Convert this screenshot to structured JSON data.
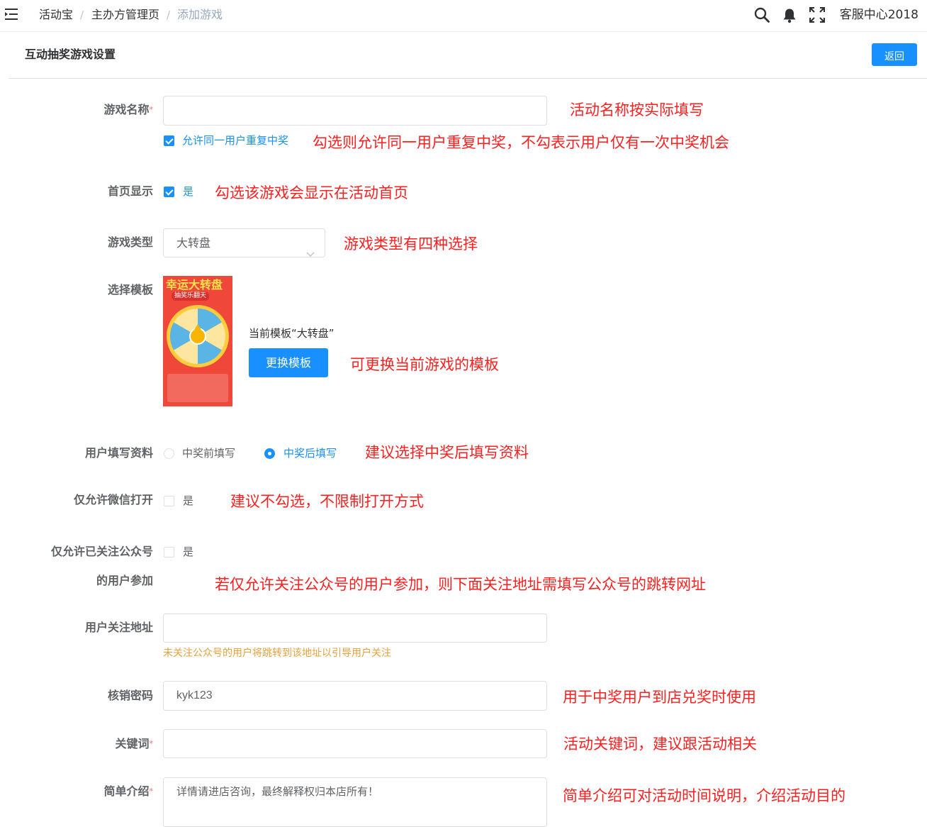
{
  "breadcrumb": {
    "items": [
      "活动宝",
      "主办方管理页",
      "添加游戏"
    ],
    "separator": "/"
  },
  "topbar": {
    "user": "客服中心2018",
    "icons": [
      "menu-fold-icon",
      "search-icon",
      "bell-icon",
      "fullscreen-icon"
    ]
  },
  "header": {
    "title": "互动抽奖游戏设置",
    "back_label": "返回"
  },
  "form": {
    "game_name": {
      "label": "游戏名称",
      "required_mark": "*",
      "value": "",
      "note": "活动名称按实际填写"
    },
    "allow_repeat": {
      "checked": true,
      "label": "允许同一用户重复中奖",
      "note": "勾选则允许同一用户重复中奖，不勾表示用户仅有一次中奖机会"
    },
    "homepage": {
      "label": "首页显示",
      "checked": true,
      "option": "是",
      "note": "勾选该游戏会显示在活动首页"
    },
    "game_type": {
      "label": "游戏类型",
      "value": "大转盘",
      "note": "游戏类型有四种选择"
    },
    "template": {
      "label": "选择模板",
      "thumb_title": "幸运大转盘",
      "thumb_subtitle": "抽奖乐翻天",
      "current": "当前模板“大转盘”",
      "change_label": "更换模板",
      "note": "可更换当前游戏的模板"
    },
    "fill_info": {
      "label": "用户填写资料",
      "options": [
        "中奖前填写",
        "中奖后填写"
      ],
      "selected": "中奖后填写",
      "note": "建议选择中奖后填写资料"
    },
    "wechat_only": {
      "label": "仅允许微信打开",
      "checked": false,
      "option": "是",
      "note": "建议不勾选，不限制打开方式"
    },
    "follow_only": {
      "label_line1": "仅允许已关注公众号",
      "label_line2": "的用户参加",
      "checked": false,
      "option": "是",
      "note": "若仅允许关注公众号的用户参加，则下面关注地址需填写公众号的跳转网址"
    },
    "follow_url": {
      "label": "用户关注地址",
      "value": "",
      "hint": "未关注公众号的用户将跳转到该地址以引导用户关注"
    },
    "verify_password": {
      "label": "核销密码",
      "value": "kyk123",
      "note": "用于中奖用户到店兑奖时使用"
    },
    "keyword": {
      "label": "关键词",
      "required_mark": "*",
      "value": "",
      "note": "活动关键词，建议跟活动相关"
    },
    "intro": {
      "label": "简单介绍",
      "required_mark": "*",
      "value": "详情请进店咨询，最终解释权归本店所有！",
      "note": "简单介绍可对活动时间说明，介绍活动目的"
    }
  },
  "colors": {
    "primary": "#1890ff",
    "annotation": "#ff1f1f",
    "hint": "#e6a23c"
  }
}
